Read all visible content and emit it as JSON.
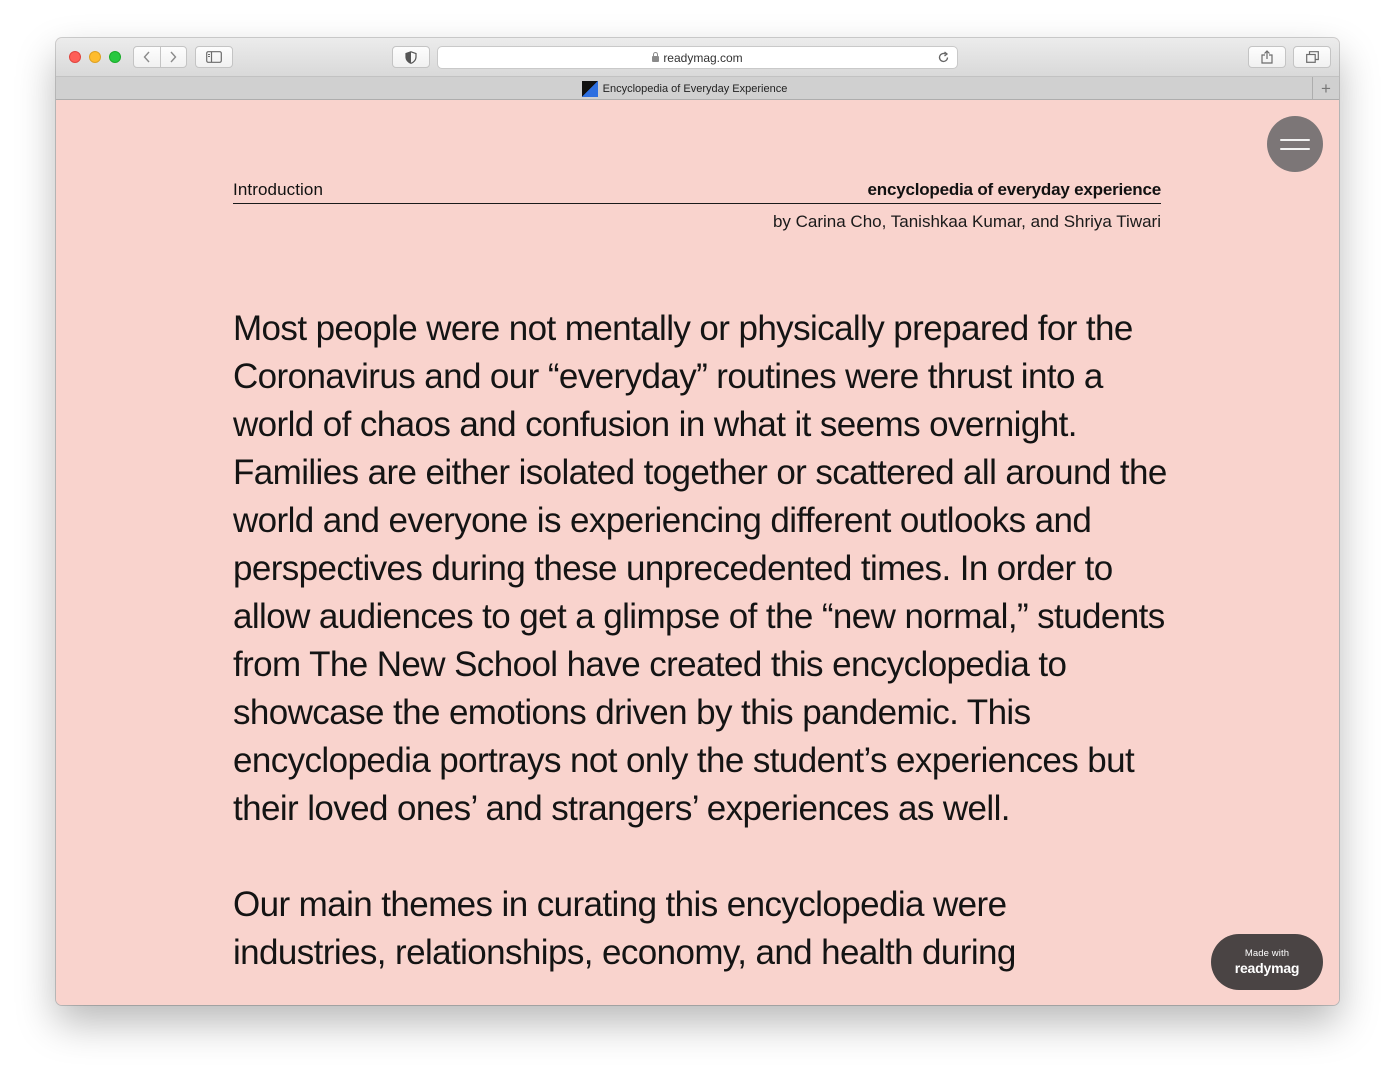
{
  "browser": {
    "url": "readymag.com",
    "tab_title": "Encyclopedia of Everyday Experience",
    "new_tab_label": "+"
  },
  "page": {
    "section_label": "Introduction",
    "site_title": "encyclopedia of everyday experience",
    "byline": "by Carina Cho, Tanishkaa Kumar, and Shriya Tiwari",
    "paragraphs": [
      "Most people were not mentally or physically prepared for the Coronavirus and our “everyday” routines were thrust into a world of chaos and confusion in what it seems overnight. Families are either isolated together or scattered all around the world and everyone is experiencing different outlooks and perspectives during these unprecedented times. In order to allow audiences to get a glimpse of the “new normal,” students from The New School have created this encyclopedia to showcase the emotions driven by this pandemic. This encyclopedia portrays not only the student’s experiences but their loved ones’ and strangers’ experiences as well.",
      "Our main themes in curating this encyclopedia were industries, relationships, economy, and health during"
    ],
    "made_with": {
      "small": "Made with",
      "brand": "readymag"
    }
  },
  "colors": {
    "page_background": "#f9d3cd",
    "text": "#141414",
    "menu_button": "#7c7677",
    "badge": "#4a4444"
  }
}
